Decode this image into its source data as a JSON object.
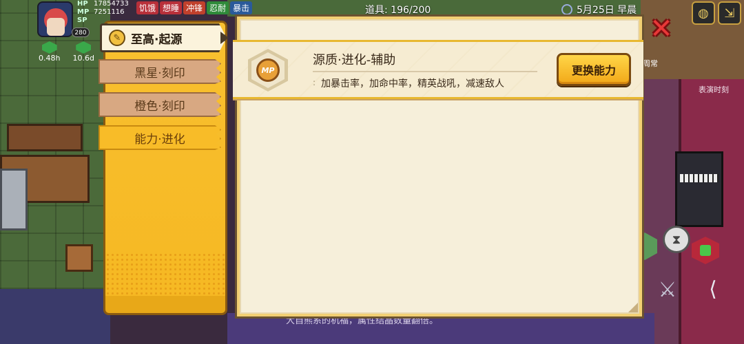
{
  "hud": {
    "level": "280",
    "stats": [
      {
        "key": "HP",
        "value": "17854733"
      },
      {
        "key": "MP",
        "value": "7251116"
      },
      {
        "key": "SP",
        "value": ""
      }
    ],
    "tags": [
      "饥饿",
      "想睡",
      "冲锋",
      "忍耐",
      "暴击"
    ],
    "timers": [
      "0.48h",
      "10.6d"
    ],
    "items_label": "道具: 196/200",
    "date": "5月25日 早晨",
    "weekday": "周常"
  },
  "background": {
    "show_label": "表演时刻",
    "bottom_text": "大自熊系的机福，属性结晶数量翻倍。"
  },
  "tabs": {
    "selected": "至高·起源",
    "items": [
      "黑星·刻印",
      "橙色·刻印",
      "能力·进化"
    ]
  },
  "ability": {
    "name": "源质·进化-辅助",
    "description": "加暴击率，加命中率，精英战吼，减速敌人",
    "bullet": ":",
    "icon_label": "MP",
    "change_button": "更换能力"
  },
  "icons": {
    "close": "close-icon",
    "pencil": "pencil-icon",
    "mp": "mp-icon",
    "hourglass": "hourglass-icon",
    "sword": "sword-icon",
    "skill": "skill-tree-icon"
  }
}
